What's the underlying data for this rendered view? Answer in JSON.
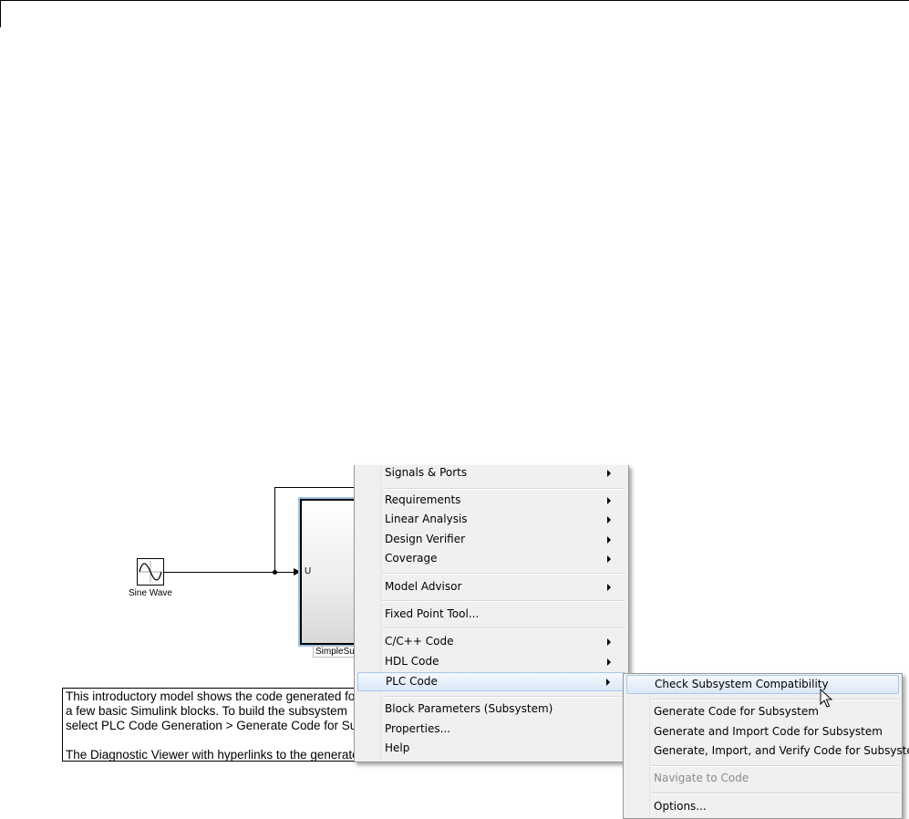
{
  "canvas": {
    "sine_label": "Sine Wave",
    "subsystem_port": "U",
    "subsystem_label": "SimpleSubsystem",
    "annotation_lines": [
      "This introductory model shows the code generated for",
      "a few basic Simulink blocks.  To build the subsystem",
      "select PLC Code Generation > Generate Code for Subsystem",
      "",
      "The Diagnostic Viewer with hyperlinks to the generated code"
    ]
  },
  "context_menu": {
    "items": [
      {
        "label": "Signals & Ports",
        "submenu": true
      },
      {
        "label": "Requirements",
        "submenu": true
      },
      {
        "label": "Linear Analysis",
        "submenu": true
      },
      {
        "label": "Design Verifier",
        "submenu": true
      },
      {
        "label": "Coverage",
        "submenu": true
      },
      {
        "label": "Model Advisor",
        "submenu": true
      },
      {
        "label": "Fixed Point Tool...",
        "submenu": false
      },
      {
        "label": "C/C++ Code",
        "submenu": true
      },
      {
        "label": "HDL Code",
        "submenu": true
      },
      {
        "label": "PLC Code",
        "submenu": true,
        "highlighted": true
      },
      {
        "label": "Block Parameters (Subsystem)",
        "submenu": false
      },
      {
        "label": "Properties...",
        "submenu": false
      },
      {
        "label": "Help",
        "submenu": false
      }
    ]
  },
  "plc_submenu": {
    "items": [
      {
        "label": "Check Subsystem Compatibility",
        "highlighted": true
      },
      {
        "label": "Generate Code for Subsystem"
      },
      {
        "label": "Generate and Import Code for Subsystem"
      },
      {
        "label": "Generate, Import, and Verify Code for Subsystem"
      },
      {
        "label": "Navigate to Code",
        "disabled": true
      },
      {
        "label": "Options..."
      }
    ]
  }
}
